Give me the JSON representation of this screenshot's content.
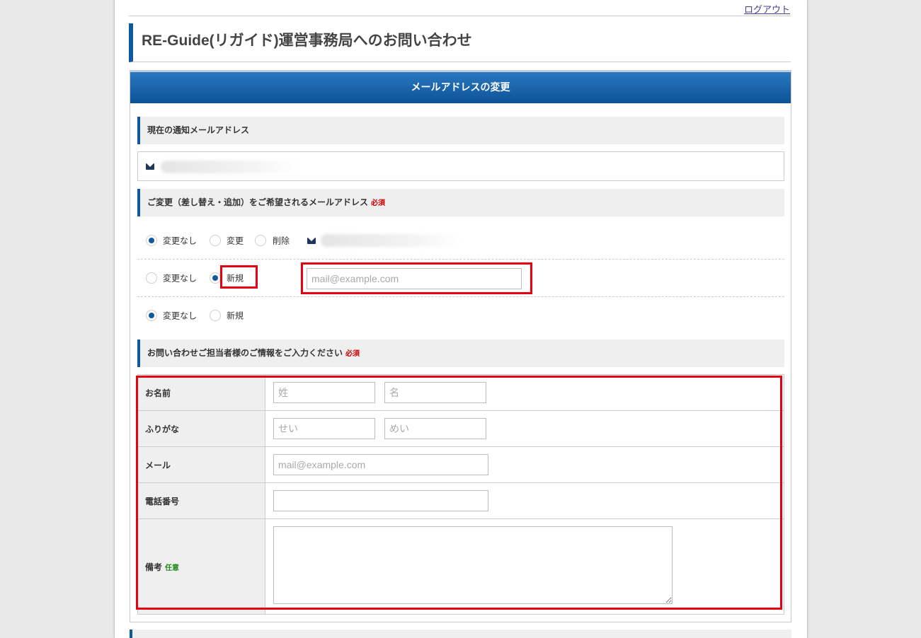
{
  "header": {
    "logout_label": "ログアウト",
    "page_title": "RE-Guide(リガイド)運営事務局へのお問い合わせ"
  },
  "panel": {
    "title": "メールアドレスの変更"
  },
  "current_email": {
    "section_title": "現在の通知メールアドレス",
    "icon": "envelope-icon"
  },
  "change_email": {
    "section_title": "ご変更（差し替え・追加）をご希望されるメールアドレス",
    "required_label": "必須",
    "row1": {
      "options": [
        "変更なし",
        "変更",
        "削除"
      ],
      "selected": "変更なし"
    },
    "row2": {
      "options": [
        "変更なし",
        "新規"
      ],
      "selected": "新規",
      "input_placeholder": "mail@example.com"
    },
    "row3": {
      "options": [
        "変更なし",
        "新規"
      ],
      "selected": "変更なし"
    }
  },
  "contact": {
    "section_title": "お問い合わせご担当者様のご情報をご入力ください",
    "required_label": "必須",
    "fields": {
      "name_label": "お名前",
      "last_name_placeholder": "姓",
      "first_name_placeholder": "名",
      "kana_label": "ふりがな",
      "last_kana_placeholder": "せい",
      "first_kana_placeholder": "めい",
      "email_label": "メール",
      "email_placeholder": "mail@example.com",
      "phone_label": "電話番号",
      "notes_label": "備考",
      "notes_optional": "任意"
    }
  },
  "colors": {
    "accent": "#0e5a9d",
    "highlight": "#e60012",
    "required": "#cc0000",
    "optional": "#1f8a1f"
  }
}
